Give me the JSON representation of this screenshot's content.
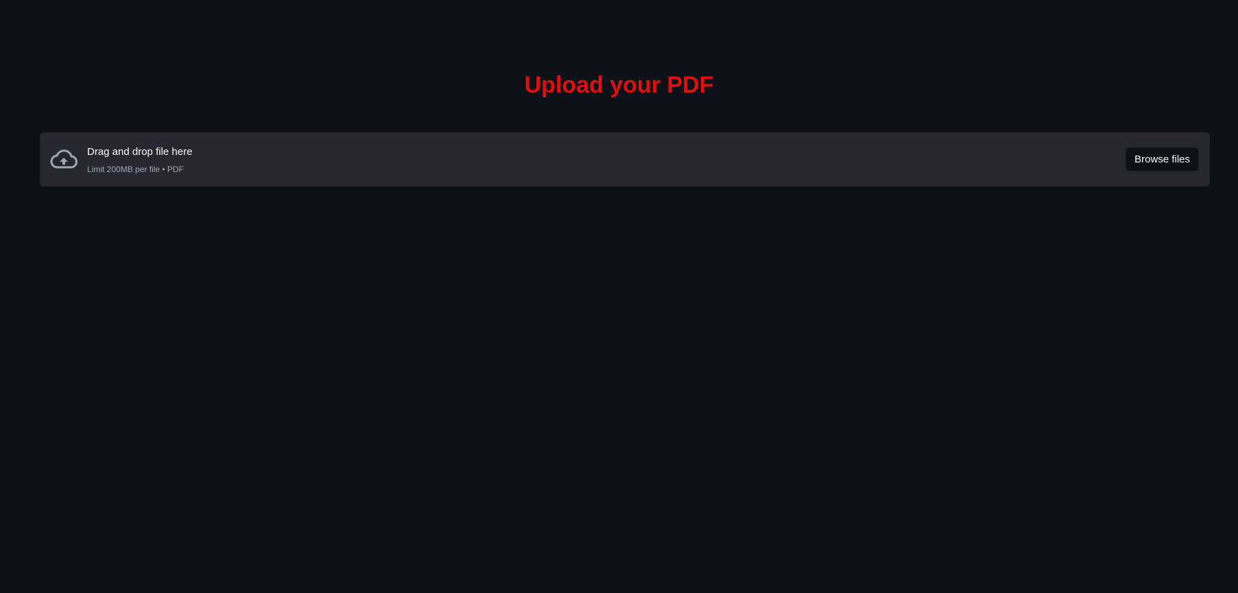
{
  "page": {
    "title": "Upload your PDF"
  },
  "uploader": {
    "icon": "cloud-upload-icon",
    "instruction": "Drag and drop file here",
    "limit_text": "Limit 200MB per file • PDF",
    "browse_label": "Browse files"
  },
  "colors": {
    "background": "#0e1117",
    "title": "#e01010",
    "dropzone": "#262730",
    "text": "#fafafa",
    "muted_text": "#a3a8b4"
  }
}
